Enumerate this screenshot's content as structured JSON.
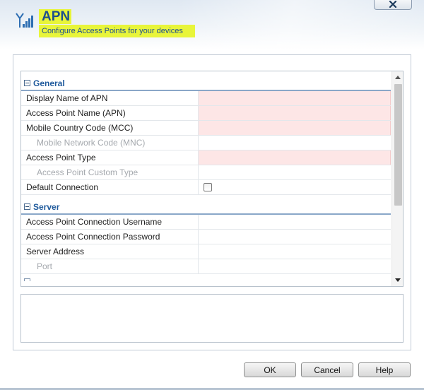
{
  "header": {
    "title": "APN",
    "subtitle": "Configure Access Points for your devices",
    "highlight_color": "#e8f53a",
    "title_color": "#1d4f8e",
    "icon": "signal-antenna-icon",
    "close_icon": "close-icon"
  },
  "grid": {
    "sections": [
      {
        "label": "General",
        "rows": [
          {
            "label": "Display Name of APN",
            "required": true,
            "sub": false,
            "value": ""
          },
          {
            "label": "Access Point Name (APN)",
            "required": true,
            "sub": false,
            "value": ""
          },
          {
            "label": "Mobile Country Code (MCC)",
            "required": true,
            "sub": false,
            "value": ""
          },
          {
            "label": "Mobile Network Code (MNC)",
            "required": false,
            "sub": true,
            "value": ""
          },
          {
            "label": "Access Point Type",
            "required": true,
            "sub": false,
            "value": ""
          },
          {
            "label": "Access Point Custom Type",
            "required": false,
            "sub": true,
            "value": ""
          },
          {
            "label": "Default Connection",
            "required": false,
            "sub": false,
            "checkbox": true,
            "checked": false
          }
        ]
      },
      {
        "label": "Server",
        "rows": [
          {
            "label": "Access Point Connection Username",
            "required": false,
            "sub": false,
            "value": ""
          },
          {
            "label": "Access Point Connection Password",
            "required": false,
            "sub": false,
            "value": ""
          },
          {
            "label": "Server Address",
            "required": false,
            "sub": false,
            "value": ""
          },
          {
            "label": "Port",
            "required": false,
            "sub": true,
            "value": ""
          }
        ]
      }
    ],
    "required_color": "#fde6e6",
    "section_color": "#1f5a9c"
  },
  "buttons": {
    "ok": "OK",
    "cancel": "Cancel",
    "help": "Help"
  }
}
